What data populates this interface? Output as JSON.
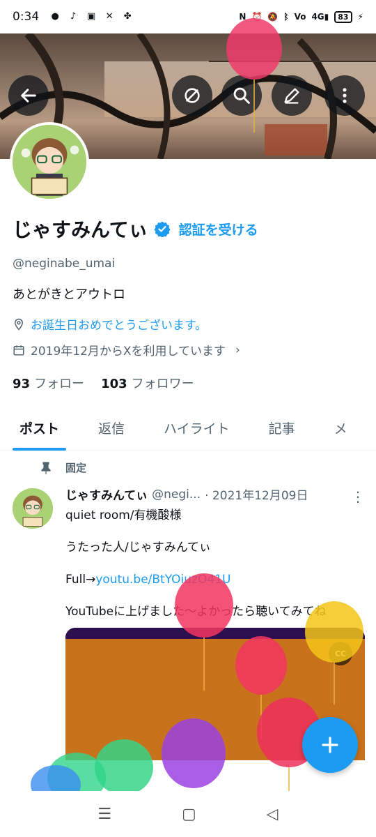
{
  "status_bar": {
    "time": "0:34",
    "apps": [
      "LINE",
      "TikTok",
      "Twitch",
      "X",
      "Pinwheel"
    ],
    "indicators": [
      "NFC",
      "Alarm",
      "Mute",
      "Bluetooth",
      "VoLTE",
      "4G"
    ],
    "battery": "83"
  },
  "header": {
    "back_icon": "arrow-left-icon",
    "actions": [
      "no-translate-icon",
      "search-icon",
      "edit-icon",
      "more-icon"
    ]
  },
  "profile": {
    "display_name": "じゃすみんてぃ",
    "verify_label": "認証を受ける",
    "handle": "@neginabe_umai",
    "bio": "あとがきとアウトロ",
    "location": "お誕生日おめでとうございます。",
    "joined": "2019年12月からXを利用しています",
    "following_count": "93",
    "following_label": "フォロー",
    "followers_count": "103",
    "followers_label": "フォロワー"
  },
  "tabs": [
    {
      "label": "ポスト",
      "active": true
    },
    {
      "label": "返信"
    },
    {
      "label": "ハイライト"
    },
    {
      "label": "記事"
    },
    {
      "label": "メ"
    }
  ],
  "pinned_tweet": {
    "pinned_label": "固定",
    "author_name": "じゃすみんてぃ",
    "author_handle": "@negi...",
    "date": "· 2021年12月09日",
    "line1": "quiet room/有機酸様",
    "line2": "うたった人/じゃすみんてぃ",
    "full_prefix": "Full→",
    "full_link": "youtu.be/BtYOiuzO41U",
    "line4": "YouTubeに上げました〜よかったら聴いてみてね",
    "cc_label": "CC"
  },
  "colors": {
    "accent": "#1d9bf0",
    "text_primary": "#0f1419",
    "text_secondary": "#536471"
  }
}
